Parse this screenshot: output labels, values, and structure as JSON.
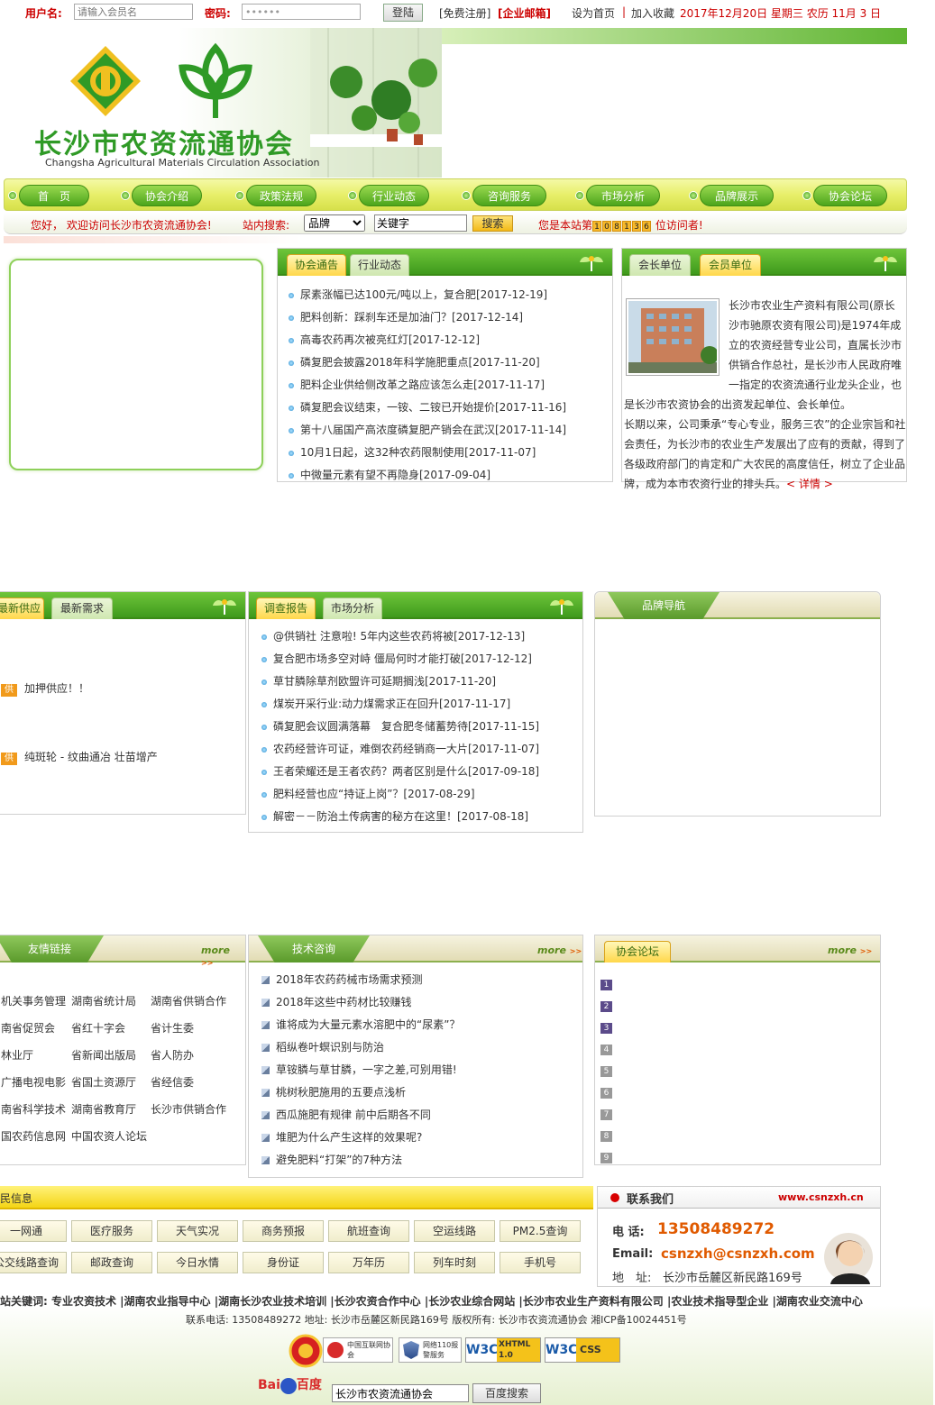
{
  "topbar": {
    "username_label": "用户名:",
    "username_placeholder": "请输入会员名",
    "password_label": "密码:",
    "password_value": "••••••",
    "login_button": "登陆",
    "register_link": "[免费注册]",
    "mail_link": "[企业邮箱]",
    "homepage_link": "设为首页",
    "divider": "|",
    "favorite_link": "加入收藏",
    "date_text": "2017年12月20日 星期三 农历 11月 3 日"
  },
  "header": {
    "site_title": "长沙市农资流通协会",
    "site_subtitle": "Changsha Agricultural Materials Circulation Association"
  },
  "nav": {
    "items": [
      "首　页",
      "协会介绍",
      "政策法规",
      "行业动态",
      "咨询服务",
      "市场分析",
      "品牌展示",
      "协会论坛"
    ]
  },
  "welcome": {
    "greeting": "您好， 欢迎访问长沙市农资流通协会!",
    "search_label": "站内搜索:",
    "search_select": "品牌",
    "search_input": "关键字",
    "search_button": "搜索",
    "visitor_prefix": "您是本站第",
    "visitor_digits": [
      "1",
      "0",
      "8",
      "1",
      "3",
      "6"
    ],
    "visitor_suffix": "位访问者!"
  },
  "notice_panel": {
    "tabs": [
      "协会通告",
      "行业动态"
    ],
    "items": [
      "尿素涨幅已达100元/吨以上，复合肥[2017-12-19]",
      "肥料创新：踩刹车还是加油门？[2017-12-14]",
      "高毒农药再次被亮红灯[2017-12-12]",
      "磷复肥会披露2018年科学施肥重点[2017-11-20]",
      "肥料企业供给侧改革之路应该怎么走[2017-11-17]",
      "磷复肥会议结束，一铵、二铵已开始提价[2017-11-16]",
      "第十八届国产高浓度磷复肥产销会在武汉[2017-11-14]",
      "10月1日起，这32种农药限制使用[2017-11-07]",
      "中微量元素有望不再隐身[2017-09-04]"
    ]
  },
  "member_panel": {
    "tabs": [
      "会长单位",
      "会员单位"
    ],
    "text_top": "长沙市农业生产资料有限公司(原长沙市驰原农资有限公司)是1974年成立的农资经营专业公司，直属长沙市供销合作总社，是长沙市人民政府唯一指定的农资流通行业龙头企业，也",
    "text_line": "是长沙市农资协会的出资发起单位、会长单位。",
    "text_bottom": "长期以来，公司秉承“专心专业，服务三农”的企业宗旨和社会责任，为长沙市的农业生产发展出了应有的贡献，得到了各级政府部门的肯定和广大农民的高度信任，树立了企业品牌，成为本市农资行业的排头兵。",
    "detail_link": "< 详情 >"
  },
  "supply_panel": {
    "tabs": [
      "最新供应",
      "最新需求"
    ],
    "badge": "供",
    "items": [
      "加押供应！！",
      "纯斑轮 - 纹曲通冶 壮苗增产"
    ]
  },
  "report_panel": {
    "tabs": [
      "调查报告",
      "市场分析"
    ],
    "items": [
      "@供销社 注意啦! 5年内这些农药将被[2017-12-13]",
      "复合肥市场多空对峙 僵局何时才能打破[2017-12-12]",
      "草甘膦除草剂欧盟许可延期搁浅[2017-11-20]",
      "煤炭开采行业:动力煤需求正在回升[2017-11-17]",
      "磷复肥会议圆满落幕　复合肥冬储蓄势待[2017-11-15]",
      "农药经营许可证，难倒农药经销商一大片[2017-11-07]",
      "王者荣耀还是王者农药？两者区别是什么[2017-09-18]",
      "肥料经营也应“持证上岗”？[2017-08-29]",
      "解密－－防治土传病害的秘方在这里！[2017-08-18]"
    ]
  },
  "brand_panel": {
    "title": "品牌导航"
  },
  "links_panel": {
    "title": "友情链接",
    "more": "more",
    "items": [
      "机关事务管理",
      "湖南省统计局",
      "湖南省供销合作",
      "南省促贸会",
      "省红十字会",
      "省计生委",
      "林业厅",
      "省新闻出版局",
      "省人防办",
      "广播电视电影",
      "省国土资源厅",
      "省经信委",
      "南省科学技术",
      "湖南省教育厅",
      "长沙市供销合作",
      "国农药信息网",
      "中国农资人论坛"
    ]
  },
  "tech_panel": {
    "title": "技术咨询",
    "more": "more",
    "items": [
      "2018年农药药械市场需求预测",
      "2018年这些中药材比较赚钱",
      "谁将成为大量元素水溶肥中的“尿素”？",
      "稻纵卷叶螟识别与防治",
      "草铵膦与草甘膦，一字之差,可别用错!",
      "桃树秋肥施用的五要点浅析",
      "西瓜施肥有规律 前中后期各不同",
      "堆肥为什么产生这样的效果呢?",
      "避免肥料“打架”的7种方法"
    ]
  },
  "forum_panel": {
    "title": "协会论坛",
    "more": "more",
    "numbers": [
      "1",
      "2",
      "3",
      "4",
      "5",
      "6",
      "7",
      "8",
      "9"
    ],
    "colors": {
      "top": "#5b4b8a",
      "rest": "#999999"
    }
  },
  "civil_panel": {
    "title": "民信息",
    "buttons": [
      "一网通",
      "医疗服务",
      "天气实况",
      "商务预报",
      "航班查询",
      "空运线路",
      "PM2.5查询",
      "公交线路查询",
      "邮政查询",
      "今日水情",
      "身份证",
      "万年历",
      "列车时刻",
      "手机号"
    ]
  },
  "contact_panel": {
    "title": "联系我们",
    "website": "www.csnzxh.cn",
    "phone_label": "电 话:",
    "phone": "13508489272",
    "email_label": "Email:",
    "email": "csnzxh@csnzxh.com",
    "address_label": "地　址:",
    "address": "长沙市岳麓区新民路169号"
  },
  "footer": {
    "keywords": "站关键词: 专业农资技术 |湖南农业指导中心 |湖南长沙农业技术培训 |长沙农资合作中心 |长沙农业综合网站 |长沙市农业生产资料有限公司 |农业技术指导型企业 |湖南农业交流中心",
    "info": "联系电话: 13508489272 地址: 长沙市岳麓区新民路169号 版权所有: 长沙市农资流通协会 湘ICP备10024451号",
    "badges": [
      "中国互联网协会",
      "网络110报警服务",
      "XHTML 1.0",
      "CSS"
    ],
    "baidu_logo": "百度",
    "baidu_input": "长沙市农资流通协会",
    "baidu_button": "百度搜索"
  },
  "colors": {
    "accent_green": "#4ca51c",
    "accent_red": "#cc0000",
    "accent_yellow": "#ffd74a"
  }
}
